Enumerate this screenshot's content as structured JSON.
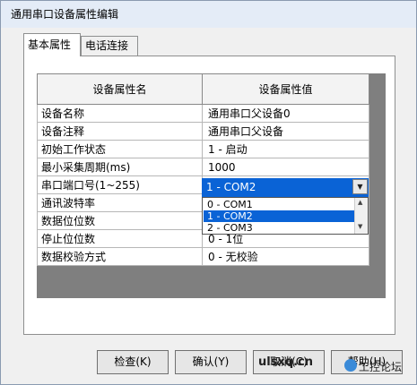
{
  "window": {
    "title": "通用串口设备属性编辑"
  },
  "tabs": [
    {
      "label": "基本属性",
      "active": true
    },
    {
      "label": "电话连接",
      "active": false
    }
  ],
  "table": {
    "columns": [
      "设备属性名",
      "设备属性值"
    ],
    "rows": [
      {
        "name": "设备名称",
        "value": "通用串口父设备0"
      },
      {
        "name": "设备注释",
        "value": "通用串口父设备"
      },
      {
        "name": "初始工作状态",
        "value": "1 - 启动"
      },
      {
        "name": "最小采集周期(ms)",
        "value": "1000"
      },
      {
        "name": "串口端口号(1~255)",
        "value": ""
      },
      {
        "name": "通讯波特率",
        "value": ""
      },
      {
        "name": "数据位位数",
        "value": ""
      },
      {
        "name": "停止位位数",
        "value": "0 - 1位"
      },
      {
        "name": "数据校验方式",
        "value": "0 - 无校验"
      }
    ]
  },
  "combo": {
    "selected": "1 - COM2",
    "options": [
      "0 - COM1",
      "1 - COM2",
      "2 - COM3"
    ],
    "highlight_index": 1
  },
  "buttons": {
    "check": "检查(K)",
    "confirm": "确认(Y)",
    "cancel": "取消(C)",
    "help": "帮助(H)"
  },
  "watermark": {
    "site": "ulsxq.cn",
    "forum": "工控论坛"
  },
  "colors": {
    "selection": "#0a63d6",
    "grid_bg": "#7f7f7f"
  }
}
